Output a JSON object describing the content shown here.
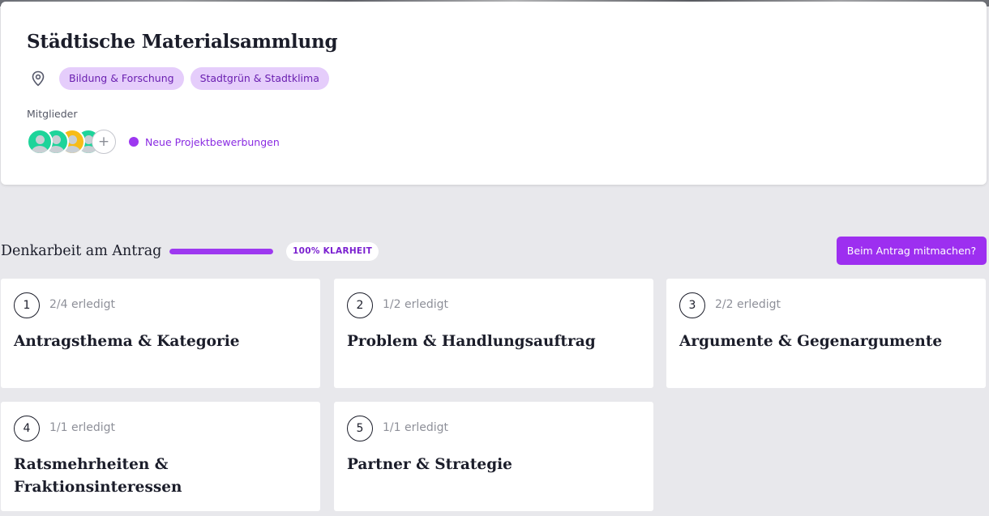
{
  "project": {
    "title": "Städtische Materialsammlung",
    "tags": [
      "Bildung & Forschung",
      "Stadtgrün & Stadtklima"
    ],
    "members_label": "Mitglieder",
    "members": [
      {
        "color": "#1ed49a"
      },
      {
        "color": "#1ed49a"
      },
      {
        "color": "#f7bc17"
      },
      {
        "color": "#1ed49a"
      }
    ],
    "add_member_symbol": "+",
    "notice": "Neue Projektbewerbungen",
    "notice_color": "#9d38f0"
  },
  "section": {
    "title": "Denkarbeit am Antrag",
    "progress_percent": 100,
    "clarity_badge": "100% KLARHEIT",
    "join_button": "Beim Antrag mitmachen?"
  },
  "steps": [
    {
      "number": "1",
      "status": "2/4 erledigt",
      "title": "Antragsthema & Kategorie"
    },
    {
      "number": "2",
      "status": "1/2 erledigt",
      "title": "Problem & Handlungsauftrag"
    },
    {
      "number": "3",
      "status": "2/2 erledigt",
      "title": "Argumente & Gegenargumente"
    },
    {
      "number": "4",
      "status": "1/1 erledigt",
      "title": "Ratsmehrheiten & Fraktionsinteressen"
    },
    {
      "number": "5",
      "status": "1/1 erledigt",
      "title": "Partner & Strategie"
    }
  ],
  "colors": {
    "accent": "#9d2ff0",
    "tag_bg": "#e5cdfb",
    "tag_text": "#6a1fb0",
    "page_bg": "#e8e8ec"
  },
  "icons": {
    "location": "location-pin-icon"
  }
}
